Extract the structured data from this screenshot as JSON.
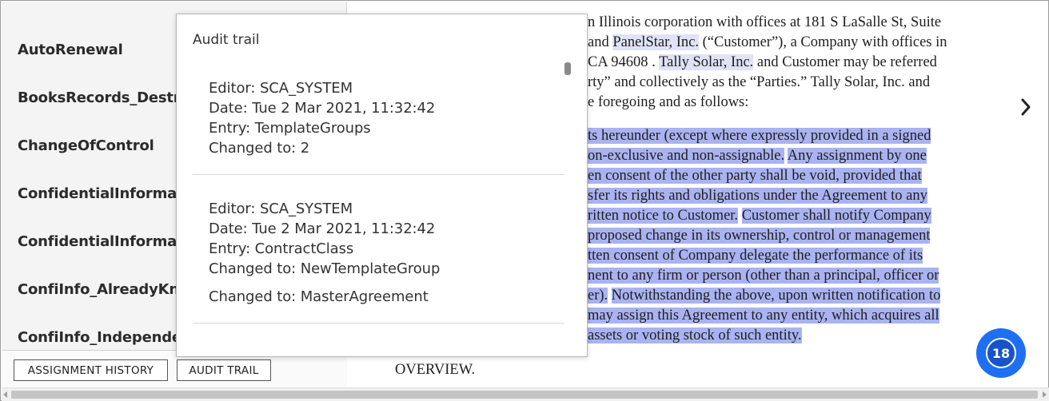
{
  "left_panel": {
    "fields": [
      "AutoRenewal",
      "BooksRecords_Destro",
      "ChangeOfControl",
      "ConfidentialInformati",
      "ConfidentialInformati",
      "ConfiInfo_AlreadyKno",
      "ConfiInfo_Independer"
    ],
    "buttons": {
      "assignment_history": "ASSIGNMENT HISTORY",
      "audit_trail": "AUDIT TRAIL"
    }
  },
  "audit_popup": {
    "title": "Audit trail",
    "entries": [
      {
        "editor": "Editor: SCA_SYSTEM",
        "date": "Date: Tue 2 Mar 2021, 11:32:42",
        "entry": "Entry: TemplateGroups",
        "changed_to": [
          "Changed to: 2"
        ]
      },
      {
        "editor": "Editor: SCA_SYSTEM",
        "date": "Date: Tue 2 Mar 2021, 11:32:42",
        "entry": "Entry: ContractClass",
        "changed_to": [
          "Changed to: NewTemplateGroup",
          "Changed to: MasterAgreement"
        ]
      }
    ]
  },
  "document": {
    "lines": [
      [
        {
          "t": "n Illinois corporation with offices at 181 S LaSalle St, Suite",
          "h": ""
        }
      ],
      [
        {
          "t": "and ",
          "h": ""
        },
        {
          "t": "PanelStar, Inc.",
          "h": "light"
        },
        {
          "t": " (“Customer”), a Company with offices in",
          "h": ""
        }
      ],
      [
        {
          "t": "CA 94608 .  ",
          "h": ""
        },
        {
          "t": "Tally Solar, Inc.",
          "h": "light"
        },
        {
          "t": " and Customer may be referred",
          "h": ""
        }
      ],
      [
        {
          "t": "rty” and collectively as the “Parties.” Tally Solar, Inc. and",
          "h": ""
        }
      ],
      [
        {
          "t": "e foregoing and as follows:",
          "h": ""
        }
      ],
      [
        {
          "t": "ts hereunder (except where expressly provided in a signed",
          "h": "strong"
        }
      ],
      [
        {
          "t": "on-exclusive and non-assignable.",
          "h": "strong"
        },
        {
          "t": " ",
          "h": ""
        },
        {
          "t": "Any assignment by one",
          "h": "strong"
        }
      ],
      [
        {
          "t": "en consent of the other party shall be void, provided that",
          "h": "strong"
        }
      ],
      [
        {
          "t": "sfer its rights and obligations under the Agreement to any",
          "h": "strong"
        }
      ],
      [
        {
          "t": "ritten notice to Customer.",
          "h": "strong"
        },
        {
          "t": " ",
          "h": ""
        },
        {
          "t": "Customer shall notify Company",
          "h": "strong"
        }
      ],
      [
        {
          "t": "proposed change in its ownership, control or management",
          "h": "strong"
        }
      ],
      [
        {
          "t": "tten consent of Company delegate the performance of its",
          "h": "strong"
        }
      ],
      [
        {
          "t": "nent to any firm or person (other than a principal, officer or",
          "h": "strong"
        }
      ],
      [
        {
          "t": "er).",
          "h": "strong"
        },
        {
          "t": " ",
          "h": ""
        },
        {
          "t": "Notwithstanding the above, upon written notification to",
          "h": "strong"
        }
      ],
      [
        {
          "t": "may assign this Agreement to any entity, which acquires all",
          "h": "strong"
        }
      ],
      [
        {
          "t": " assets or voting stock of such entity.",
          "h": "strong"
        }
      ]
    ],
    "footer_text": "OVERVIEW."
  },
  "badge": {
    "count": "18"
  },
  "colors": {
    "highlight_strong": "#a9b3f1",
    "highlight_light": "#dfe3f5",
    "badge_blue": "#1e6ff1"
  },
  "icons": {
    "next": "chevron-right-icon"
  }
}
